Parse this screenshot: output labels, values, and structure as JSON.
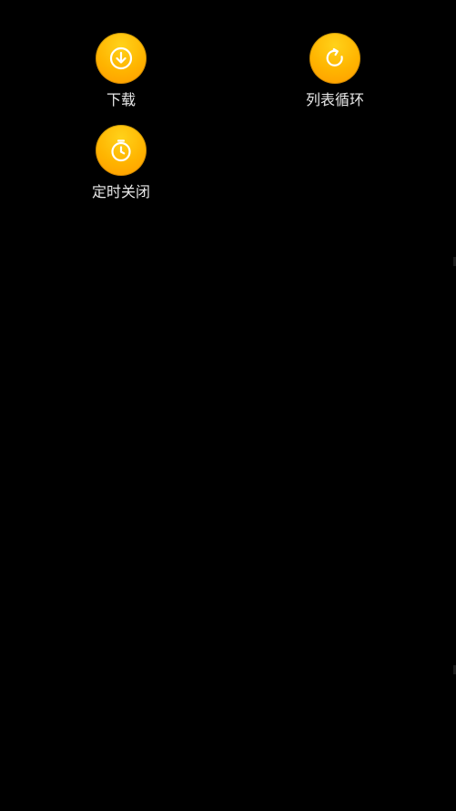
{
  "actions": {
    "download": {
      "label": "下载",
      "icon": "download-icon"
    },
    "loop": {
      "label": "列表循环",
      "icon": "loop-icon"
    },
    "timer": {
      "label": "定时关闭",
      "icon": "timer-icon"
    }
  },
  "colors": {
    "background": "#000000",
    "accent": "#ffb400",
    "label": "#e8e8e8"
  }
}
